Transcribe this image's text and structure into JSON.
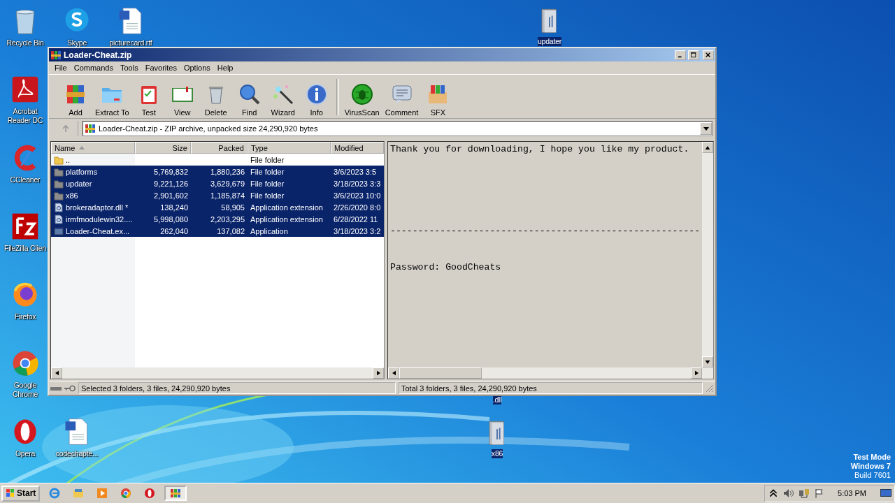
{
  "desktop_icons": [
    {
      "label": "Recycle Bin",
      "kind": "recycle",
      "selected": false
    },
    {
      "label": "Skype",
      "kind": "skype",
      "selected": false
    },
    {
      "label": "picturecard.rtf",
      "kind": "word",
      "selected": false
    },
    {
      "label": "updater",
      "kind": "folder",
      "selected": true
    },
    {
      "label": "Acrobat Reader DC",
      "kind": "acrobat",
      "selected": false
    },
    {
      "label": "CCleaner",
      "kind": "ccleaner",
      "selected": false
    },
    {
      "label": "FileZilla Clien",
      "kind": "filezilla",
      "selected": false
    },
    {
      "label": "Firefox",
      "kind": "firefox",
      "selected": false
    },
    {
      "label": "Google Chrome",
      "kind": "chrome",
      "selected": false
    },
    {
      "label": "Opera",
      "kind": "opera",
      "selected": false
    },
    {
      "label": "codechapte...",
      "kind": "word",
      "selected": false
    },
    {
      "label": ".dll",
      "kind": "none",
      "selected": true
    },
    {
      "label": "x86",
      "kind": "folder",
      "selected": true
    }
  ],
  "window": {
    "title": "Loader-Cheat.zip",
    "menu": [
      "File",
      "Commands",
      "Tools",
      "Favorites",
      "Options",
      "Help"
    ],
    "toolbar": [
      [
        {
          "label": "Add",
          "kind": "add"
        },
        {
          "label": "Extract To",
          "kind": "extract"
        },
        {
          "label": "Test",
          "kind": "test"
        },
        {
          "label": "View",
          "kind": "view"
        },
        {
          "label": "Delete",
          "kind": "delete"
        },
        {
          "label": "Find",
          "kind": "find"
        },
        {
          "label": "Wizard",
          "kind": "wizard"
        },
        {
          "label": "Info",
          "kind": "info"
        }
      ],
      [
        {
          "label": "VirusScan",
          "kind": "virus"
        },
        {
          "label": "Comment",
          "kind": "comment"
        },
        {
          "label": "SFX",
          "kind": "sfx"
        }
      ]
    ],
    "address": "Loader-Cheat.zip - ZIP archive, unpacked size 24,290,920 bytes",
    "columns": [
      {
        "label": "Name",
        "sorted": true
      },
      {
        "label": "Size",
        "sorted": false
      },
      {
        "label": "Packed",
        "sorted": false
      },
      {
        "label": "Type",
        "sorted": false
      },
      {
        "label": "Modified",
        "sorted": false
      }
    ],
    "rows": [
      {
        "name": "..",
        "type": "File folder",
        "kind": "parent",
        "selected": false
      },
      {
        "name": "platforms",
        "size": "5,769,832",
        "packed": "1,880,236",
        "type": "File folder",
        "modified": "3/6/2023 3:5",
        "kind": "folder",
        "selected": true
      },
      {
        "name": "updater",
        "size": "9,221,126",
        "packed": "3,629,679",
        "type": "File folder",
        "modified": "3/18/2023 3:3",
        "kind": "folder",
        "selected": true
      },
      {
        "name": "x86",
        "size": "2,901,602",
        "packed": "1,185,874",
        "type": "File folder",
        "modified": "3/6/2023 10:0",
        "kind": "folder",
        "selected": true
      },
      {
        "name": "brokeradaptor.dll *",
        "size": "138,240",
        "packed": "58,905",
        "type": "Application extension",
        "modified": "2/26/2020 8:0",
        "kind": "dll",
        "selected": true
      },
      {
        "name": "irmfmodulewin32....",
        "size": "5,998,080",
        "packed": "2,203,295",
        "type": "Application extension",
        "modified": "6/28/2022 11",
        "kind": "dll",
        "selected": true
      },
      {
        "name": "Loader-Cheat.ex...",
        "size": "262,040",
        "packed": "137,082",
        "type": "Application",
        "modified": "3/18/2023 3:2",
        "kind": "exe",
        "selected": true
      }
    ],
    "comment_lines": [
      "Thank you for downloading, I hope you like my product.",
      "--------------------------------------------------------",
      "Password: GoodCheats"
    ],
    "status_left": "Selected 3 folders, 3 files, 24,290,920 bytes",
    "status_right": "Total 3 folders, 3 files, 24,290,920 bytes"
  },
  "os_info": [
    "Test Mode",
    "Windows 7",
    "Build 7601"
  ],
  "taskbar": {
    "start": "Start",
    "apps": [
      {
        "kind": "ie",
        "selected": false
      },
      {
        "kind": "explorer",
        "selected": false
      },
      {
        "kind": "media",
        "selected": false
      },
      {
        "kind": "chrome",
        "selected": false
      },
      {
        "kind": "opera",
        "selected": false
      },
      {
        "kind": "winrar",
        "selected": true
      }
    ],
    "clock": "5:03 PM"
  }
}
